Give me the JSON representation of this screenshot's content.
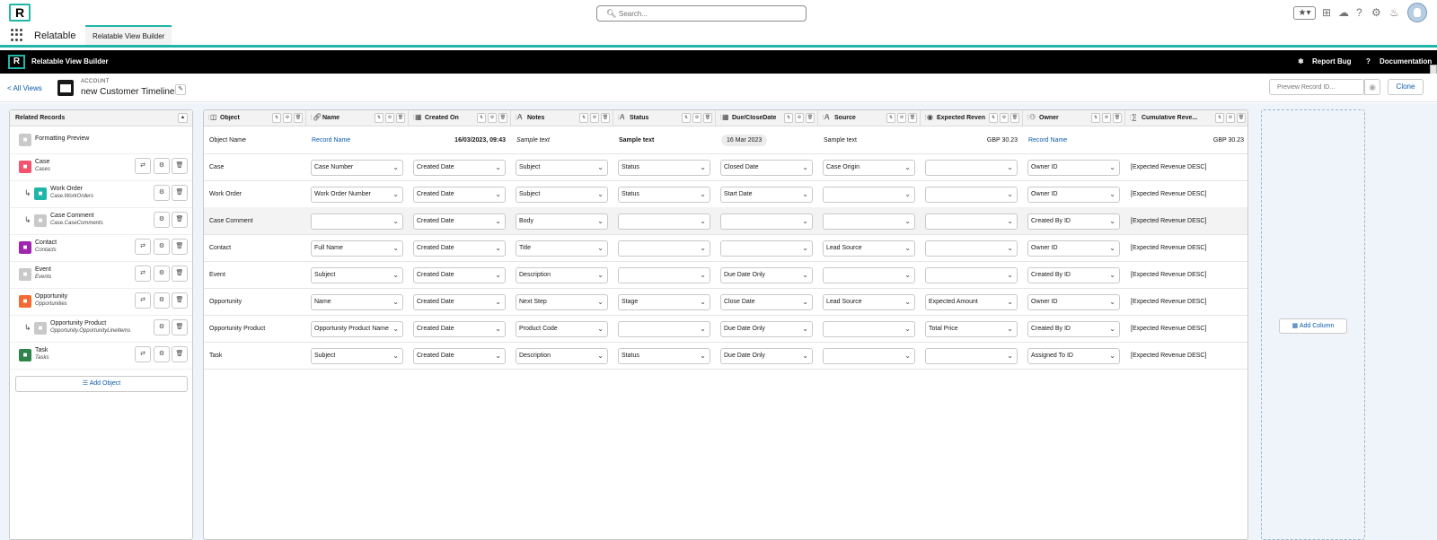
{
  "global_header": {
    "logo": "R",
    "search_placeholder": "Search...",
    "icons": [
      "favorites-star-icon",
      "add-icon",
      "trailhead-icon",
      "help-icon",
      "setup-gear-icon",
      "notifications-bell-icon",
      "avatar"
    ]
  },
  "nav": {
    "app_name": "Relatable",
    "tab": "Relatable View Builder"
  },
  "toolbar": {
    "title": "Relatable View Builder",
    "report_bug": "Report Bug",
    "documentation": "Documentation"
  },
  "subheader": {
    "all_views": "< All Views",
    "object_label": "ACCOUNT",
    "view_name": "new Customer Timeline",
    "preview_placeholder": "Preview Record ID...",
    "clone": "Clone"
  },
  "related_panel": {
    "title": "Related Records",
    "items": [
      {
        "name": "Formatting Preview",
        "sub": "",
        "icon_color": "#c9c9c9",
        "child": false,
        "sort": false
      },
      {
        "name": "Case",
        "sub": "Cases",
        "icon_color": "#f2536d",
        "child": false,
        "sort": true
      },
      {
        "name": "Work Order",
        "sub": "Case.WorkOrders",
        "icon_color": "#1fb6a8",
        "child": true,
        "sort": false
      },
      {
        "name": "Case Comment",
        "sub": "Case.CaseComments",
        "icon_color": "#c9c9c9",
        "child": true,
        "sort": false
      },
      {
        "name": "Contact",
        "sub": "Contacts",
        "icon_color": "#a026b0",
        "child": false,
        "sort": true
      },
      {
        "name": "Event",
        "sub": "Events",
        "icon_color": "#c9c9c9",
        "child": false,
        "sort": true
      },
      {
        "name": "Opportunity",
        "sub": "Opportunities",
        "icon_color": "#f46a33",
        "child": false,
        "sort": true
      },
      {
        "name": "Opportunity Product",
        "sub": "Opportunity.OpportunityLineItems",
        "icon_color": "#c9c9c9",
        "child": true,
        "sort": false
      },
      {
        "name": "Task",
        "sub": "Tasks",
        "icon_color": "#2e844a",
        "child": false,
        "sort": true
      }
    ],
    "add_object": "Add Object"
  },
  "grid": {
    "columns": [
      {
        "label": "Object",
        "icon": "object-icon"
      },
      {
        "label": "Name",
        "icon": "link-icon"
      },
      {
        "label": "Created On",
        "icon": "calendar-icon"
      },
      {
        "label": "Notes",
        "icon": "text-icon"
      },
      {
        "label": "Status",
        "icon": "text-icon"
      },
      {
        "label": "Due/CloseDate",
        "icon": "calendar-icon"
      },
      {
        "label": "Source",
        "icon": "text-icon"
      },
      {
        "label": "Expected Reven",
        "icon": "currency-icon"
      },
      {
        "label": "Owner",
        "icon": "user-icon"
      },
      {
        "label": "Cumulative Reve...",
        "icon": "formula-icon"
      }
    ],
    "preview_row": {
      "object": "Object Name",
      "name": "Record Name",
      "created": "16/03/2023, 09:43",
      "notes": "Sample text",
      "status": "Sample text",
      "due": "16 Mar 2023",
      "source": "Sample text",
      "expected": "GBP 30.23",
      "owner": "Record Name",
      "cumulative": "GBP 30.23"
    },
    "rows": [
      {
        "object": "Case",
        "cells": [
          "Case Number",
          "Created Date",
          "Subject",
          "Status",
          "Closed Date",
          "Case Origin",
          "",
          "Owner ID"
        ],
        "cumulative": "[Expected Revenue DESC]"
      },
      {
        "object": "Work Order",
        "cells": [
          "Work Order Number",
          "Created Date",
          "Subject",
          "Status",
          "Start Date",
          "",
          "",
          "Owner ID"
        ],
        "cumulative": "[Expected Revenue DESC]"
      },
      {
        "object": "Case Comment",
        "cells": [
          "",
          "Created Date",
          "Body",
          "",
          "",
          "",
          "",
          "Created By ID"
        ],
        "cumulative": "[Expected Revenue DESC]"
      },
      {
        "object": "Contact",
        "cells": [
          "Full Name",
          "Created Date",
          "Title",
          "",
          "",
          "Lead Source",
          "",
          "Owner ID"
        ],
        "cumulative": "[Expected Revenue DESC]"
      },
      {
        "object": "Event",
        "cells": [
          "Subject",
          "Created Date",
          "Description",
          "",
          "Due Date Only",
          "",
          "",
          "Created By ID"
        ],
        "cumulative": "[Expected Revenue DESC]"
      },
      {
        "object": "Opportunity",
        "cells": [
          "Name",
          "Created Date",
          "Next Step",
          "Stage",
          "Close Date",
          "Lead Source",
          "Expected Amount",
          "Owner ID"
        ],
        "cumulative": "[Expected Revenue DESC]"
      },
      {
        "object": "Opportunity Product",
        "cells": [
          "Opportunity Product Name",
          "Created Date",
          "Product Code",
          "",
          "Due Date Only",
          "",
          "Total Price",
          "Created By ID"
        ],
        "cumulative": "[Expected Revenue DESC]"
      },
      {
        "object": "Task",
        "cells": [
          "Subject",
          "Created Date",
          "Description",
          "Status",
          "Due Date Only",
          "",
          "",
          "Assigned To ID"
        ],
        "cumulative": "[Expected Revenue DESC]"
      }
    ]
  },
  "add_column": "Add Column"
}
